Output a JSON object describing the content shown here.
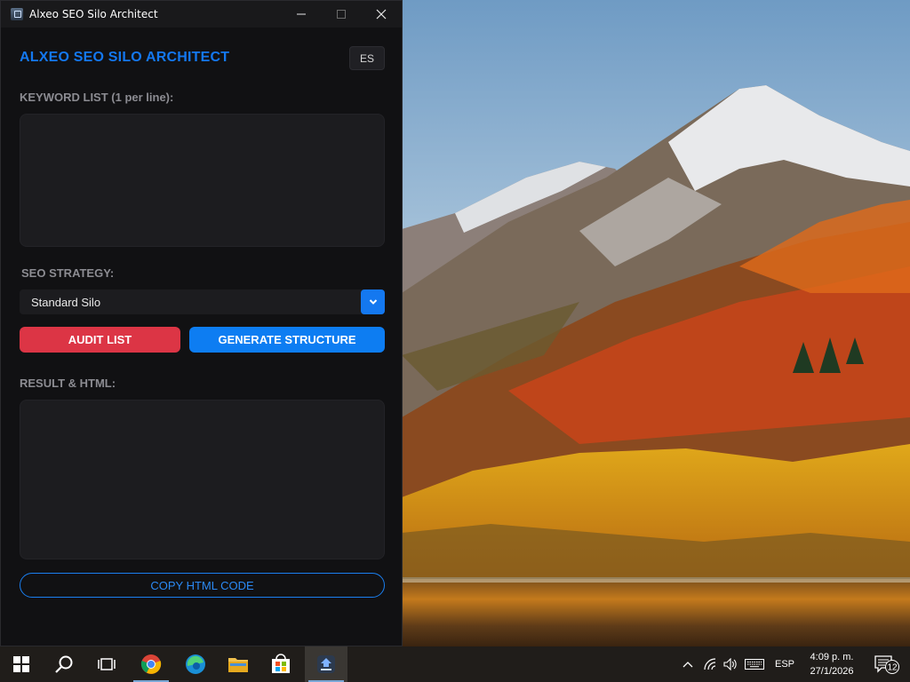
{
  "window": {
    "title": "Alxeo SEO Silo Architect"
  },
  "app": {
    "brand": "ALXEO SEO SILO ARCHITECT",
    "language_button": "ES",
    "keywords_label": "KEYWORD LIST (1 per line):",
    "keywords_value": "",
    "strategy_label": "SEO STRATEGY:",
    "strategy_selected": "Standard Silo",
    "audit_button": "AUDIT LIST",
    "generate_button": "GENERATE STRUCTURE",
    "result_label": "RESULT & HTML:",
    "result_value": "",
    "copy_button": "COPY HTML CODE"
  },
  "taskbar": {
    "items": [
      {
        "name": "start",
        "icon": "windows-logo-icon"
      },
      {
        "name": "search",
        "icon": "search-icon"
      },
      {
        "name": "task-view",
        "icon": "task-view-icon"
      },
      {
        "name": "chrome",
        "icon": "chrome-icon"
      },
      {
        "name": "edge",
        "icon": "edge-icon"
      },
      {
        "name": "file-explorer",
        "icon": "folder-icon"
      },
      {
        "name": "store",
        "icon": "store-icon"
      },
      {
        "name": "alxeo-app",
        "icon": "app-icon",
        "active": true
      }
    ],
    "language": "ESP",
    "time": "4:09 p. m.",
    "date": "27/1/2026",
    "notifications": "12"
  },
  "colors": {
    "accent": "#1478f0",
    "danger": "#dc3545",
    "window_bg": "#111113"
  }
}
